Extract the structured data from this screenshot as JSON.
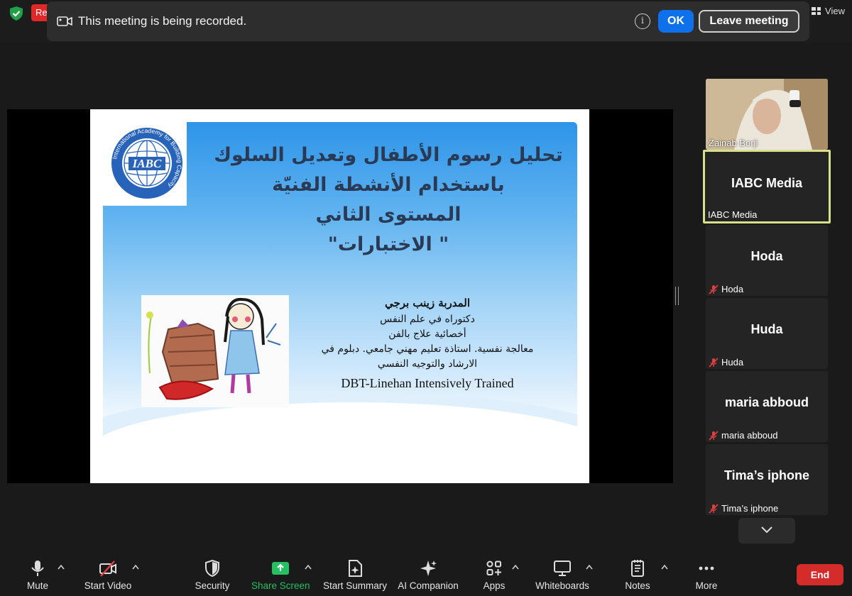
{
  "recording_indicator": "Re",
  "view_label": "View",
  "banner": {
    "message": "This meeting is being recorded.",
    "ok_label": "OK",
    "leave_label": "Leave meeting"
  },
  "slide": {
    "title_lines": [
      "تحليل رسوم الأطفال وتعديل السلوك",
      "باستخدام الأنشطة الفنيّة",
      "المستوى الثاني",
      "\" الاختبارات\""
    ],
    "logo_text": "IABC",
    "logo_ring_text": "International Academy for Building Capacity",
    "trainer_name": "المدربة زينب برجي",
    "lines": [
      "دكتوراه في علم النفس",
      "أخصائية علاج بالفن",
      "معالجة نفسية. استاذة تعليم مهني جامعي. دبلوم في",
      "الارشاد والتوجيه النفسي"
    ],
    "english_line": "DBT-Linehan Intensively Trained"
  },
  "participants": [
    {
      "name": "Zainab Borji",
      "type": "video",
      "muted": false
    },
    {
      "name": "IABC Media",
      "display": "IABC Media",
      "muted": false,
      "active": true
    },
    {
      "name": "Hoda",
      "display": "Hoda",
      "muted": true
    },
    {
      "name": "Huda",
      "display": "Huda",
      "muted": true
    },
    {
      "name": "maria abboud",
      "display": "maria abboud",
      "muted": true
    },
    {
      "name": "Tima’s iphone",
      "display": "Tima’s iphone",
      "muted": true
    }
  ],
  "toolbar": {
    "mute": "Mute",
    "start_video": "Start Video",
    "security": "Security",
    "share_screen": "Share Screen",
    "start_summary": "Start Summary",
    "ai_companion": "AI Companion",
    "apps": "Apps",
    "whiteboards": "Whiteboards",
    "notes": "Notes",
    "more": "More",
    "end": "End"
  },
  "colors": {
    "accent_blue": "#0e71eb",
    "end_red": "#d42b2b",
    "share_green": "#24c062",
    "active_speaker_border": "#d8e08a"
  }
}
